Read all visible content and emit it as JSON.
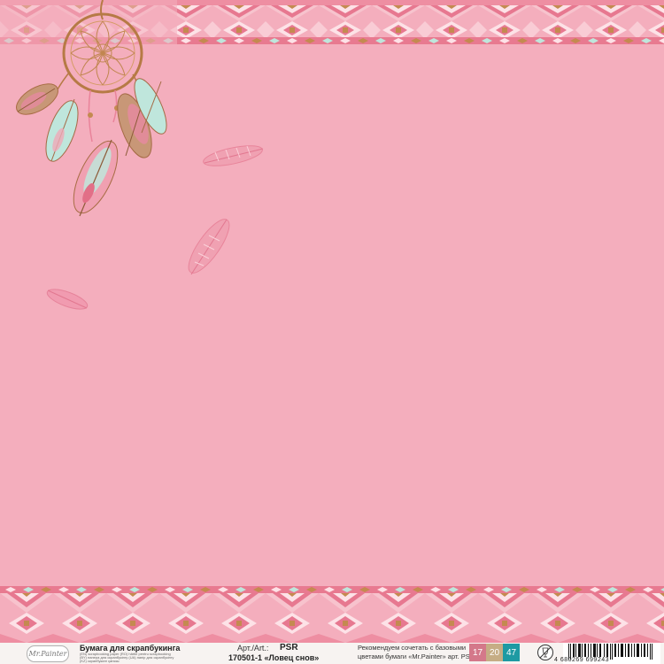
{
  "colors": {
    "background": "#f4aebd",
    "band_dark": "#e8728a",
    "band_light": "#fbd9df",
    "gold": "#c48a50",
    "mint": "#bfe6dc"
  },
  "decor": {
    "dreamcatcher_icon": "dreamcatcher-icon",
    "feather_icon": "feather-icon"
  },
  "footer": {
    "brand": "Mr.Painter",
    "product_title": "Бумага для скрапбукинга",
    "fine_line_1": "(EN) scrapbooking paper (RO) hârtie pentru scrapbooking",
    "fine_line_2": "(BY) папера для скрапбукінгу (UA) папір для скрапбукінгу",
    "fine_line_3": "(KZ) скрапбукинг қағазы",
    "art_label": "Арт./Art.:",
    "art_code": "PSR",
    "art_number": "170501-1 «Ловец снов»",
    "recommend_line_1": "Рекомендуем сочетать с базовыми",
    "recommend_line_2": "цветами бумаги «Mr.Painter» арт. PST",
    "swatches": [
      "17",
      "20",
      "47"
    ],
    "swatch_colors": [
      "#d4788a",
      "#c6ad85",
      "#1e9aa3"
    ],
    "barcode_digits": "4 680269 699243"
  }
}
